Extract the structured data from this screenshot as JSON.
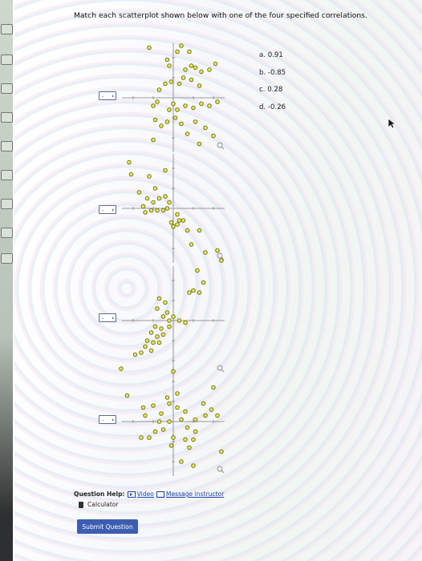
{
  "question": "Match each scatterplot shown below with one of the four specified correlations.",
  "answers": [
    "a. 0.91",
    "b. -0.85",
    "c. 0.28",
    "d. -0.26"
  ],
  "dropdowns": [
    {
      "value": "-"
    },
    {
      "value": "-"
    },
    {
      "value": "-"
    },
    {
      "value": "-"
    }
  ],
  "help": {
    "label": "Question Help:",
    "video": "Video",
    "message": "Message instructor",
    "calculator": "Calculator"
  },
  "submit_label": "Submit Question",
  "colors": {
    "point_fill": "#e6e85a",
    "point_stroke": "#6b6a10",
    "button": "#3d5db0",
    "link": "#1c47a8"
  },
  "chart_data": [
    {
      "type": "scatter",
      "shown_correlation": "negative",
      "zoom_icon": "magnifier-icon",
      "points": [
        [
          -1.2,
          2.5
        ],
        [
          0.2,
          2.3
        ],
        [
          0.4,
          2.6
        ],
        [
          0.8,
          2.3
        ],
        [
          -0.3,
          1.9
        ],
        [
          -0.2,
          1.6
        ],
        [
          0.9,
          1.6
        ],
        [
          0.6,
          1.4
        ],
        [
          1.1,
          1.5
        ],
        [
          1.4,
          1.3
        ],
        [
          1.8,
          1.4
        ],
        [
          2.1,
          1.7
        ],
        [
          -0.7,
          0.4
        ],
        [
          -0.4,
          0.7
        ],
        [
          -0.1,
          0.8
        ],
        [
          0.3,
          0.7
        ],
        [
          0.5,
          1.0
        ],
        [
          0.9,
          0.9
        ],
        [
          1.3,
          0.6
        ],
        [
          -1.0,
          -0.4
        ],
        [
          -0.8,
          -0.2
        ],
        [
          -0.2,
          -0.6
        ],
        [
          0.0,
          -0.3
        ],
        [
          0.2,
          -0.6
        ],
        [
          0.6,
          -0.4
        ],
        [
          1.0,
          -0.5
        ],
        [
          1.4,
          -0.3
        ],
        [
          1.8,
          -0.4
        ],
        [
          2.2,
          -0.2
        ],
        [
          -0.9,
          -1.1
        ],
        [
          -0.6,
          -1.4
        ],
        [
          -0.3,
          -1.2
        ],
        [
          0.1,
          -1.0
        ],
        [
          0.4,
          -1.3
        ],
        [
          1.1,
          -1.2
        ],
        [
          1.6,
          -1.5
        ],
        [
          2.0,
          -1.9
        ],
        [
          -1.0,
          -2.1
        ],
        [
          0.7,
          -1.8
        ],
        [
          1.3,
          -2.3
        ]
      ]
    },
    {
      "type": "scatter",
      "shown_correlation": "negative",
      "zoom_icon": "magnifier-icon",
      "points": [
        [
          -2.2,
          2.3
        ],
        [
          -2.1,
          1.7
        ],
        [
          -1.2,
          1.6
        ],
        [
          -0.4,
          1.9
        ],
        [
          -0.9,
          1.0
        ],
        [
          -1.7,
          0.8
        ],
        [
          -1.3,
          0.5
        ],
        [
          -1.0,
          0.3
        ],
        [
          -0.7,
          0.5
        ],
        [
          -0.4,
          0.6
        ],
        [
          -0.2,
          0.3
        ],
        [
          -1.5,
          0.1
        ],
        [
          -1.1,
          -0.1
        ],
        [
          -0.8,
          -0.1
        ],
        [
          -0.5,
          -0.1
        ],
        [
          -0.3,
          0.0
        ],
        [
          -1.4,
          -0.2
        ],
        [
          0.2,
          -0.3
        ],
        [
          0.3,
          -0.6
        ],
        [
          0.0,
          -0.9
        ],
        [
          0.2,
          -0.8
        ],
        [
          -0.1,
          -0.7
        ],
        [
          0.5,
          -0.6
        ],
        [
          0.7,
          -1.1
        ],
        [
          1.3,
          -1.1
        ],
        [
          0.9,
          -1.8
        ],
        [
          1.6,
          -2.2
        ],
        [
          2.2,
          -2.1
        ],
        [
          2.4,
          -2.6
        ]
      ]
    },
    {
      "type": "scatter",
      "shown_correlation": "positive",
      "zoom_icon": "magnifier-icon",
      "points": [
        [
          1.2,
          2.5
        ],
        [
          1.5,
          1.9
        ],
        [
          1.0,
          1.5
        ],
        [
          0.8,
          1.4
        ],
        [
          1.3,
          1.4
        ],
        [
          -0.7,
          1.1
        ],
        [
          -0.4,
          0.9
        ],
        [
          -0.8,
          0.6
        ],
        [
          -0.3,
          0.4
        ],
        [
          -0.5,
          0.2
        ],
        [
          0.0,
          0.2
        ],
        [
          -0.2,
          0.0
        ],
        [
          0.3,
          0.0
        ],
        [
          0.6,
          -0.1
        ],
        [
          -0.9,
          -0.3
        ],
        [
          -0.6,
          -0.4
        ],
        [
          -0.2,
          -0.3
        ],
        [
          -1.1,
          -0.6
        ],
        [
          -0.8,
          -0.8
        ],
        [
          -0.5,
          -0.7
        ],
        [
          -1.3,
          -1.0
        ],
        [
          -1.0,
          -1.1
        ],
        [
          -0.7,
          -1.1
        ],
        [
          -1.4,
          -1.3
        ],
        [
          -1.1,
          -1.5
        ],
        [
          -1.9,
          -1.7
        ],
        [
          -1.6,
          -1.6
        ],
        [
          -2.6,
          -2.4
        ]
      ]
    },
    {
      "type": "scatter",
      "shown_correlation": "positive",
      "zoom_icon": "magnifier-icon",
      "points": [
        [
          0.0,
          2.5
        ],
        [
          -2.3,
          1.3
        ],
        [
          -0.3,
          1.2
        ],
        [
          0.2,
          1.4
        ],
        [
          2.0,
          1.7
        ],
        [
          -1.5,
          0.7
        ],
        [
          -1.0,
          0.8
        ],
        [
          -0.2,
          0.9
        ],
        [
          0.2,
          0.7
        ],
        [
          1.5,
          0.9
        ],
        [
          -1.4,
          0.3
        ],
        [
          -0.6,
          0.4
        ],
        [
          0.6,
          0.5
        ],
        [
          1.9,
          0.6
        ],
        [
          -0.7,
          0.0
        ],
        [
          -0.2,
          0.0
        ],
        [
          0.4,
          0.1
        ],
        [
          1.1,
          0.1
        ],
        [
          1.6,
          0.3
        ],
        [
          2.2,
          0.3
        ],
        [
          -0.9,
          -0.5
        ],
        [
          -0.5,
          -0.4
        ],
        [
          0.7,
          -0.3
        ],
        [
          1.1,
          -0.5
        ],
        [
          -1.6,
          -0.8
        ],
        [
          -1.2,
          -0.8
        ],
        [
          0.0,
          -0.8
        ],
        [
          0.6,
          -0.9
        ],
        [
          1.0,
          -0.9
        ],
        [
          -0.1,
          -1.2
        ],
        [
          0.8,
          -1.3
        ],
        [
          2.4,
          -1.5
        ],
        [
          0.4,
          -2.0
        ],
        [
          1.0,
          -2.2
        ]
      ]
    }
  ]
}
